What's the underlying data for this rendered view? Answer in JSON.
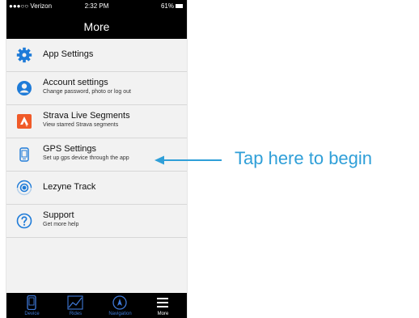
{
  "status_bar": {
    "carrier": "●●●○○ Verizon ",
    "time": "2:32 PM",
    "battery": "61%"
  },
  "nav": {
    "title": "More"
  },
  "menu": {
    "items": [
      {
        "title": "App Settings",
        "subtitle": ""
      },
      {
        "title": "Account settings",
        "subtitle": "Change password, photo or log out"
      },
      {
        "title": "Strava Live Segments",
        "subtitle": "View starred Strava segments"
      },
      {
        "title": "GPS Settings",
        "subtitle": "Set up gps device through the app"
      },
      {
        "title": "Lezyne Track",
        "subtitle": ""
      },
      {
        "title": "Support",
        "subtitle": "Get more help"
      }
    ]
  },
  "tabs": [
    {
      "label": "Device",
      "icon": "device-icon"
    },
    {
      "label": "Rides",
      "icon": "rides-icon"
    },
    {
      "label": "Navigation",
      "icon": "navigation-icon"
    },
    {
      "label": "More",
      "icon": "more-icon"
    }
  ],
  "annotation": {
    "text": "Tap here to begin"
  },
  "colors": {
    "accent_blue": "#1e7bd8",
    "strava_orange": "#f05a28",
    "annotation_blue": "#2f9fd8",
    "tab_blue": "#3f79d8"
  }
}
